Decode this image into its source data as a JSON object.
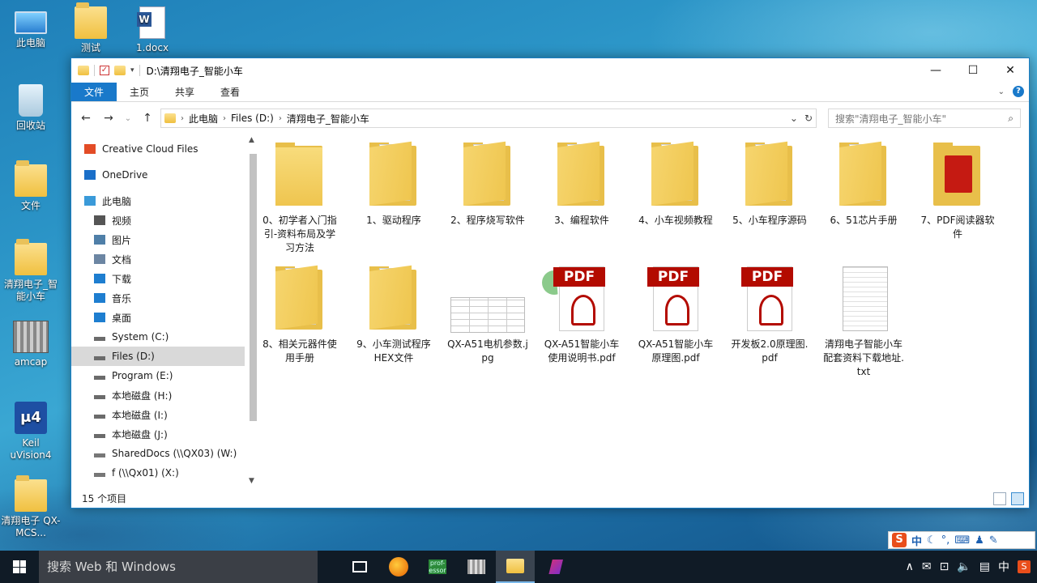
{
  "desktop": {
    "icons": [
      {
        "label": "此电脑",
        "icon": "this-pc-icon"
      },
      {
        "label": "测试",
        "icon": "folder-icon"
      },
      {
        "label": "1.docx",
        "icon": "word-document-icon"
      },
      {
        "label": "回收站",
        "icon": "recycle-bin-icon"
      },
      {
        "label": "文件",
        "icon": "folder-icon"
      },
      {
        "label": "清翔电子_智能小车",
        "icon": "folder-shortcut-icon"
      },
      {
        "label": "amcap",
        "icon": "amcap-icon"
      },
      {
        "label": "Keil uVision4",
        "icon": "keil-icon"
      },
      {
        "label": "清翔电子 QX-MCS...",
        "icon": "folder-shortcut-icon"
      }
    ]
  },
  "window": {
    "title": "D:\\清翔电子_智能小车",
    "controls": {
      "minimize": "—",
      "maximize": "☐",
      "close": "✕"
    },
    "ribbon_tabs": [
      "文件",
      "主页",
      "共享",
      "查看"
    ],
    "address": {
      "crumbs": [
        "此电脑",
        "Files (D:)",
        "清翔电子_智能小车"
      ]
    },
    "search_placeholder": "搜索\"清翔电子_智能小车\"",
    "nav_items": [
      {
        "label": "Creative Cloud Files",
        "icon": "creative-cloud-icon"
      },
      {
        "label": "OneDrive",
        "icon": "onedrive-icon"
      },
      {
        "label": "此电脑",
        "icon": "this-pc-icon"
      },
      {
        "label": "视频",
        "icon": "videos-icon"
      },
      {
        "label": "图片",
        "icon": "pictures-icon"
      },
      {
        "label": "文档",
        "icon": "documents-icon"
      },
      {
        "label": "下载",
        "icon": "downloads-icon"
      },
      {
        "label": "音乐",
        "icon": "music-icon"
      },
      {
        "label": "桌面",
        "icon": "desktop-icon"
      },
      {
        "label": "System (C:)",
        "icon": "drive-icon"
      },
      {
        "label": "Files (D:)",
        "icon": "drive-icon",
        "selected": true
      },
      {
        "label": "Program (E:)",
        "icon": "drive-icon"
      },
      {
        "label": "本地磁盘 (H:)",
        "icon": "drive-icon"
      },
      {
        "label": "本地磁盘 (I:)",
        "icon": "drive-icon"
      },
      {
        "label": "本地磁盘 (J:)",
        "icon": "drive-icon"
      },
      {
        "label": "SharedDocs (\\\\QX03) (W:)",
        "icon": "network-drive-icon"
      },
      {
        "label": "f (\\\\Qx01) (X:)",
        "icon": "network-drive-icon"
      }
    ],
    "files": [
      {
        "name": "0、初学者入门指引-资料布局及学习方法",
        "type": "folder-empty"
      },
      {
        "name": "1、驱动程序",
        "type": "folder-docs"
      },
      {
        "name": "2、程序烧写软件",
        "type": "folder-docs"
      },
      {
        "name": "3、编程软件",
        "type": "folder-docs"
      },
      {
        "name": "4、小车视频教程",
        "type": "folder-docs"
      },
      {
        "name": "5、小车程序源码",
        "type": "folder-docs"
      },
      {
        "name": "6、51芯片手册",
        "type": "folder-pdf"
      },
      {
        "name": "7、PDF阅读器软件",
        "type": "folder-pdfapp"
      },
      {
        "name": "8、相关元器件使用手册",
        "type": "folder-pdf"
      },
      {
        "name": "9、小车测试程序HEX文件",
        "type": "folder-docs"
      },
      {
        "name": "QX-A51电机参数.jpg",
        "type": "jpg"
      },
      {
        "name": "QX-A51智能小车使用说明书.pdf",
        "type": "pdf"
      },
      {
        "name": "QX-A51智能小车原理图.pdf",
        "type": "pdf"
      },
      {
        "name": "开发板2.0原理图.pdf",
        "type": "pdf"
      },
      {
        "name": "清翔电子智能小车配套资料下载地址.txt",
        "type": "txt"
      }
    ],
    "pdf_badge": "PDF",
    "status": "15 个项目"
  },
  "taskbar": {
    "search_placeholder": "搜索 Web 和 Windows",
    "apps": [
      "task-view-icon",
      "firefox-icon",
      "professor-icon",
      "app-icon",
      "file-explorer-icon",
      "app-icon"
    ],
    "professor_label": "prof-essor",
    "ime_mode": "中"
  },
  "ime_toolbar": {
    "logo": "S",
    "mode": "中"
  },
  "colors": {
    "accent": "#1979ca",
    "folder": "#f0c040",
    "pdf": "#b30b00",
    "taskbar": "#101b26"
  }
}
